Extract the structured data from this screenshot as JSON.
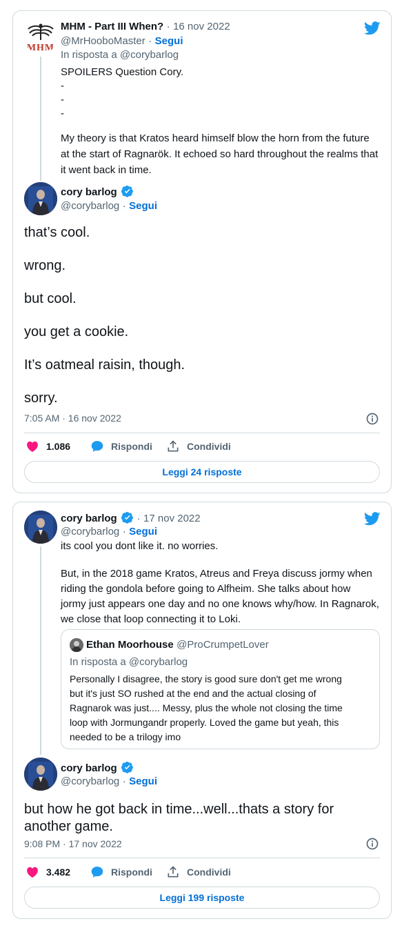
{
  "card1": {
    "parent": {
      "name": "MHM - Part III When?",
      "date_sep": "·",
      "date": "16 nov 2022",
      "handle": "@MrHooboMaster",
      "follow": "Segui",
      "reply_to": "In risposta a @corybarlog",
      "text_lines": [
        "SPOILERS Question Cory.",
        "-",
        "-",
        "-",
        "My theory is that Kratos heard himself blow the horn from the future",
        "at the start of Ragnarök. It echoed so hard throughout the realms that",
        "it went back in time."
      ],
      "avatar_logo": "MHM"
    },
    "main": {
      "name": "cory barlog",
      "handle": "@corybarlog",
      "follow": "Segui",
      "lines": [
        "that’s cool.",
        "wrong.",
        "but cool.",
        "you get a cookie.",
        "It’s oatmeal raisin, though.",
        "sorry."
      ],
      "timestamp": "7:05 AM · 16 nov 2022",
      "likes": "1.086",
      "reply_label": "Rispondi",
      "share_label": "Condividi",
      "read_replies": "Leggi 24 risposte"
    }
  },
  "card2": {
    "parent": {
      "name": "cory barlog",
      "date_sep": "·",
      "date": "17 nov 2022",
      "handle": "@corybarlog",
      "follow": "Segui",
      "text_lines": [
        "its cool you dont like it. no worries.",
        "",
        "But, in the 2018 game Kratos, Atreus and Freya discuss jormy when",
        "riding the gondola before going to Alfheim. She talks about how",
        "jormy just appears one day and no one knows why/how. In Ragnarok,",
        "we close that loop connecting it to Loki."
      ],
      "quote": {
        "name": "Ethan Moorhouse",
        "handle": "@ProCrumpetLover",
        "reply_to": "In risposta a @corybarlog",
        "text_lines": [
          "Personally I disagree, the story is good sure don't get me wrong",
          "but it's just SO rushed at the end and the actual closing of",
          "Ragnarok was just.... Messy, plus the whole not closing the time",
          "loop with Jormungandr properly. Loved the game but yeah, this",
          "needed to be a trilogy imo"
        ]
      }
    },
    "main": {
      "name": "cory barlog",
      "handle": "@corybarlog",
      "follow": "Segui",
      "lines": [
        "but how he got back in time...well...thats a story for",
        "another game."
      ],
      "timestamp": "9:08 PM · 17 nov 2022",
      "likes": "3.482",
      "reply_label": "Rispondi",
      "share_label": "Condividi",
      "read_replies": "Leggi 199 risposte"
    }
  },
  "icons": {
    "twitter": "twitter-bird-icon",
    "verified": "verified-badge-icon",
    "info": "info-icon",
    "like": "heart-icon",
    "reply": "speech-bubble-icon",
    "share": "share-upload-icon"
  },
  "colors": {
    "twitter_blue": "#1d9bf0",
    "link_blue": "#006fd6",
    "like_pink": "#f91880",
    "border": "#cfd9de",
    "muted_text": "#536471"
  }
}
